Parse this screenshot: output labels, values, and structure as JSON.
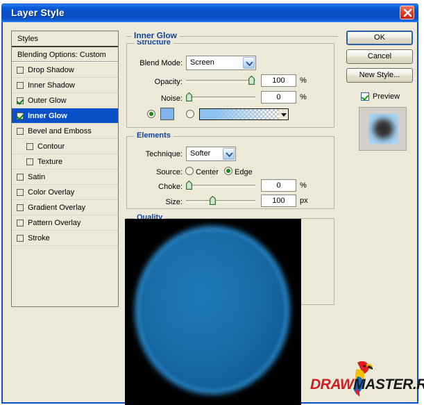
{
  "window": {
    "title": "Layer Style",
    "close_icon": "close-x-icon"
  },
  "styles_panel": {
    "header": "Styles",
    "blending_options": "Blending Options: Custom",
    "items": [
      {
        "label": "Drop Shadow",
        "checked": false,
        "selected": false,
        "indent": false
      },
      {
        "label": "Inner Shadow",
        "checked": false,
        "selected": false,
        "indent": false
      },
      {
        "label": "Outer Glow",
        "checked": true,
        "selected": false,
        "indent": false
      },
      {
        "label": "Inner Glow",
        "checked": true,
        "selected": true,
        "indent": false
      },
      {
        "label": "Bevel and Emboss",
        "checked": false,
        "selected": false,
        "indent": false
      },
      {
        "label": "Contour",
        "checked": false,
        "selected": false,
        "indent": true
      },
      {
        "label": "Texture",
        "checked": false,
        "selected": false,
        "indent": true
      },
      {
        "label": "Satin",
        "checked": false,
        "selected": false,
        "indent": false
      },
      {
        "label": "Color Overlay",
        "checked": false,
        "selected": false,
        "indent": false
      },
      {
        "label": "Gradient Overlay",
        "checked": false,
        "selected": false,
        "indent": false
      },
      {
        "label": "Pattern Overlay",
        "checked": false,
        "selected": false,
        "indent": false
      },
      {
        "label": "Stroke",
        "checked": false,
        "selected": false,
        "indent": false
      }
    ]
  },
  "panel": {
    "title": "Inner Glow",
    "structure": {
      "legend": "Structure",
      "blend_mode_label": "Blend Mode:",
      "blend_mode_value": "Screen",
      "opacity_label": "Opacity:",
      "opacity_value": "100",
      "opacity_unit": "%",
      "noise_label": "Noise:",
      "noise_value": "0",
      "noise_unit": "%",
      "color_radio_selected": true,
      "color_swatch": "#7fb4e8",
      "gradient_radio_selected": false,
      "gradient_start_color": "#8cc0ee"
    },
    "elements": {
      "legend": "Elements",
      "technique_label": "Technique:",
      "technique_value": "Softer",
      "source_label": "Source:",
      "source_center": "Center",
      "source_edge": "Edge",
      "source_selected": "Edge",
      "choke_label": "Choke:",
      "choke_value": "0",
      "choke_unit": "%",
      "size_label": "Size:",
      "size_value": "100",
      "size_unit": "px"
    },
    "quality": {
      "legend": "Quality"
    }
  },
  "buttons": {
    "ok": "OK",
    "cancel": "Cancel",
    "new_style": "New Style...",
    "preview_label": "Preview",
    "preview_checked": true
  },
  "watermark": {
    "part1": "DRAW",
    "part2": "MASTER.RU"
  }
}
